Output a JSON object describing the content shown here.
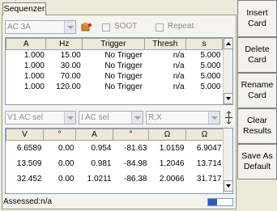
{
  "tab": {
    "label": "Sequenzer"
  },
  "controls": {
    "ac_select": "AC 3A",
    "soot_label": "SOOT",
    "repeat_label": "Repeat"
  },
  "seq_table": {
    "headers": [
      "A",
      "Hz",
      "Trigger",
      "Thresh",
      "s"
    ],
    "rows": [
      [
        "1.000",
        "15.00",
        "No Trigger",
        "n/a",
        "5.000"
      ],
      [
        "1.000",
        "30.00",
        "No Trigger",
        "n/a",
        "5.000"
      ],
      [
        "1.000",
        "70.00",
        "No Trigger",
        "n/a",
        "5.000"
      ],
      [
        "1.000",
        "120.00",
        "No Trigger",
        "n/a",
        "5.000"
      ]
    ]
  },
  "selectors": {
    "v_select": "V1 AC sel",
    "i_select": "I AC sel",
    "rx_select": "R,X"
  },
  "result_table": {
    "headers": [
      "V",
      "°",
      "A",
      "°",
      "Ω",
      "Ω"
    ],
    "rows": [
      [
        "6.6589",
        "0.00",
        "0.954",
        "-81.63",
        "1.0159",
        "6.9047"
      ],
      [
        "13.509",
        "0.00",
        "0.981",
        "-84.98",
        "1.2046",
        "13.714"
      ],
      [
        "32.452",
        "0.00",
        "1.0211",
        "-86.38",
        "2.0066",
        "31.717"
      ]
    ]
  },
  "status": {
    "text": "Assessed:n/a"
  },
  "progress": {
    "fraction": 0.35,
    "color": "#2f57c6"
  },
  "buttons": {
    "insert": "Insert\nCard",
    "delete": "Delete\nCard",
    "rename": "Rename\nCard",
    "clear": "Clear\nResults",
    "save": "Save As\nDefault"
  }
}
